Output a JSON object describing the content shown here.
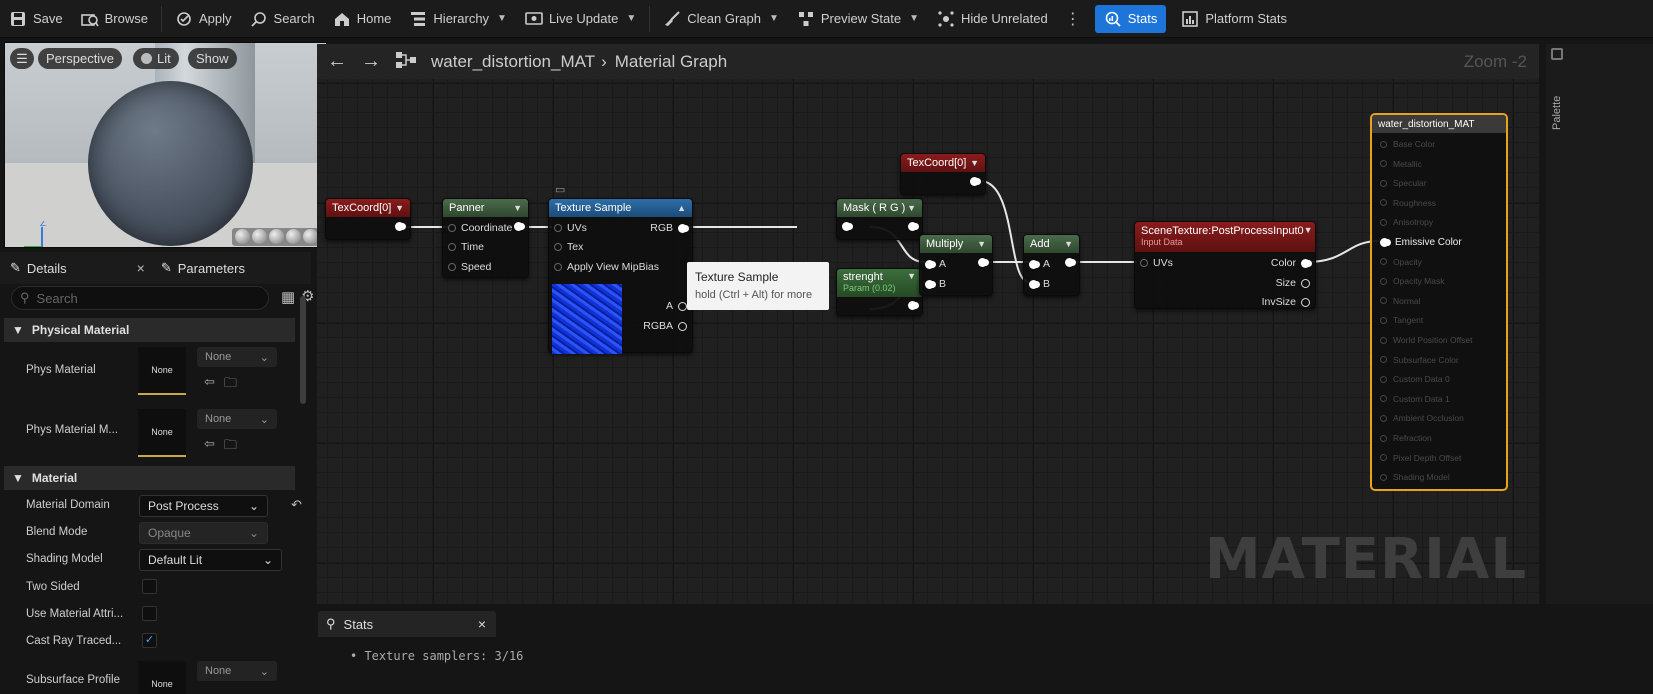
{
  "toolbar": {
    "save": "Save",
    "browse": "Browse",
    "apply": "Apply",
    "search": "Search",
    "home": "Home",
    "hierarchy": "Hierarchy",
    "live_update": "Live Update",
    "clean_graph": "Clean Graph",
    "preview_state": "Preview State",
    "hide_unrelated": "Hide Unrelated",
    "stats": "Stats",
    "platform_stats": "Platform Stats"
  },
  "viewport": {
    "perspective": "Perspective",
    "lit": "Lit",
    "show": "Show",
    "axis_z": "Z",
    "axis_x": "X"
  },
  "details": {
    "tab_details": "Details",
    "tab_parameters": "Parameters",
    "search_placeholder": "Search",
    "section_physical": "Physical Material",
    "phys_material": "Phys Material",
    "phys_material_mask": "Phys Material M...",
    "none": "None",
    "section_material": "Material",
    "material_domain_label": "Material Domain",
    "material_domain_value": "Post Process",
    "blend_mode_label": "Blend Mode",
    "blend_mode_value": "Opaque",
    "shading_model_label": "Shading Model",
    "shading_model_value": "Default Lit",
    "two_sided": "Two Sided",
    "use_material_attr": "Use Material Attri...",
    "cast_ray_traced": "Cast Ray Traced...",
    "subsurface_profile": "Subsurface Profile",
    "cast_ray_traced_checked": true
  },
  "graph": {
    "breadcrumb_asset": "water_distortion_MAT",
    "breadcrumb_view": "Material Graph",
    "zoom": "Zoom -2",
    "watermark": "MATERIAL",
    "palette": "Palette",
    "nodes": {
      "texcoord1": "TexCoord[0]",
      "texcoord2": "TexCoord[0]",
      "panner": "Panner",
      "panner_coordinate": "Coordinate",
      "panner_time": "Time",
      "panner_speed": "Speed",
      "texsample": "Texture Sample",
      "ts_uvs": "UVs",
      "ts_tex": "Tex",
      "ts_mip": "Apply View MipBias",
      "ts_rgb": "RGB",
      "ts_a": "A",
      "ts_rgba": "RGBA",
      "mask": "Mask ( R G )",
      "strength": "strenght",
      "strength_sub": "Param (0.02)",
      "multiply": "Multiply",
      "add": "Add",
      "pin_a": "A",
      "pin_b": "B",
      "scene": "SceneTexture:PostProcessInput0",
      "scene_sub": "Input Data",
      "scene_uvs": "UVs",
      "scene_color": "Color",
      "scene_size": "Size",
      "scene_invsize": "InvSize",
      "result": "water_distortion_MAT"
    },
    "result_pins": [
      "Base Color",
      "Metallic",
      "Specular",
      "Roughness",
      "Anisotropy",
      "Emissive Color",
      "Opacity",
      "Opacity Mask",
      "Normal",
      "Tangent",
      "World Position Offset",
      "Subsurface Color",
      "Custom Data 0",
      "Custom Data 1",
      "Ambient Occlusion",
      "Refraction",
      "Pixel Depth Offset",
      "Shading Model"
    ],
    "tooltip_title": "Texture Sample",
    "tooltip_sub": "hold (Ctrl + Alt) for more"
  },
  "stats": {
    "tab": "Stats",
    "line": "• Texture samplers: 3/16"
  },
  "colors": {
    "accent": "#1d74d9",
    "result_border": "#e9a21b"
  }
}
